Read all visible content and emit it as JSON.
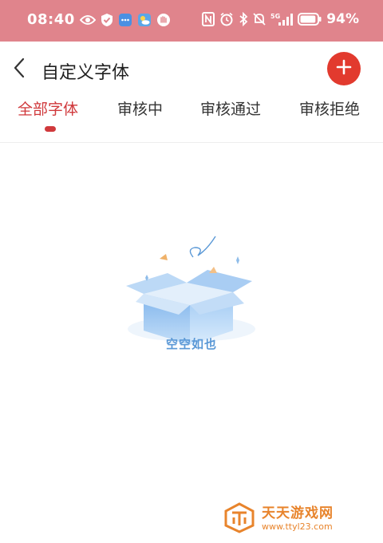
{
  "status_bar": {
    "time": "08:40",
    "battery": "94%",
    "network": "5G",
    "background_color": "#e0848c",
    "left_icons": [
      "eye-icon",
      "shield-check-icon",
      "message-icon",
      "weather-icon",
      "hand-icon"
    ],
    "right_icons": [
      "nfc-icon",
      "alarm-icon",
      "bluetooth-icon",
      "mute-icon",
      "signal-icon",
      "battery-icon"
    ]
  },
  "header": {
    "title": "自定义字体",
    "back_icon": "chevron-left-icon",
    "add_icon": "plus-icon",
    "add_button_color": "#e23a2e"
  },
  "tabs": {
    "active_color": "#d0393c",
    "items": [
      {
        "label": "全部字体",
        "active": true
      },
      {
        "label": "审核中",
        "active": false
      },
      {
        "label": "审核通过",
        "active": false
      },
      {
        "label": "审核拒绝",
        "active": false
      }
    ]
  },
  "empty_state": {
    "text": "空空如也",
    "illustration": "open-box-icon"
  },
  "watermark": {
    "name": "天天游戏网",
    "url": "www.ttyl23.com"
  }
}
